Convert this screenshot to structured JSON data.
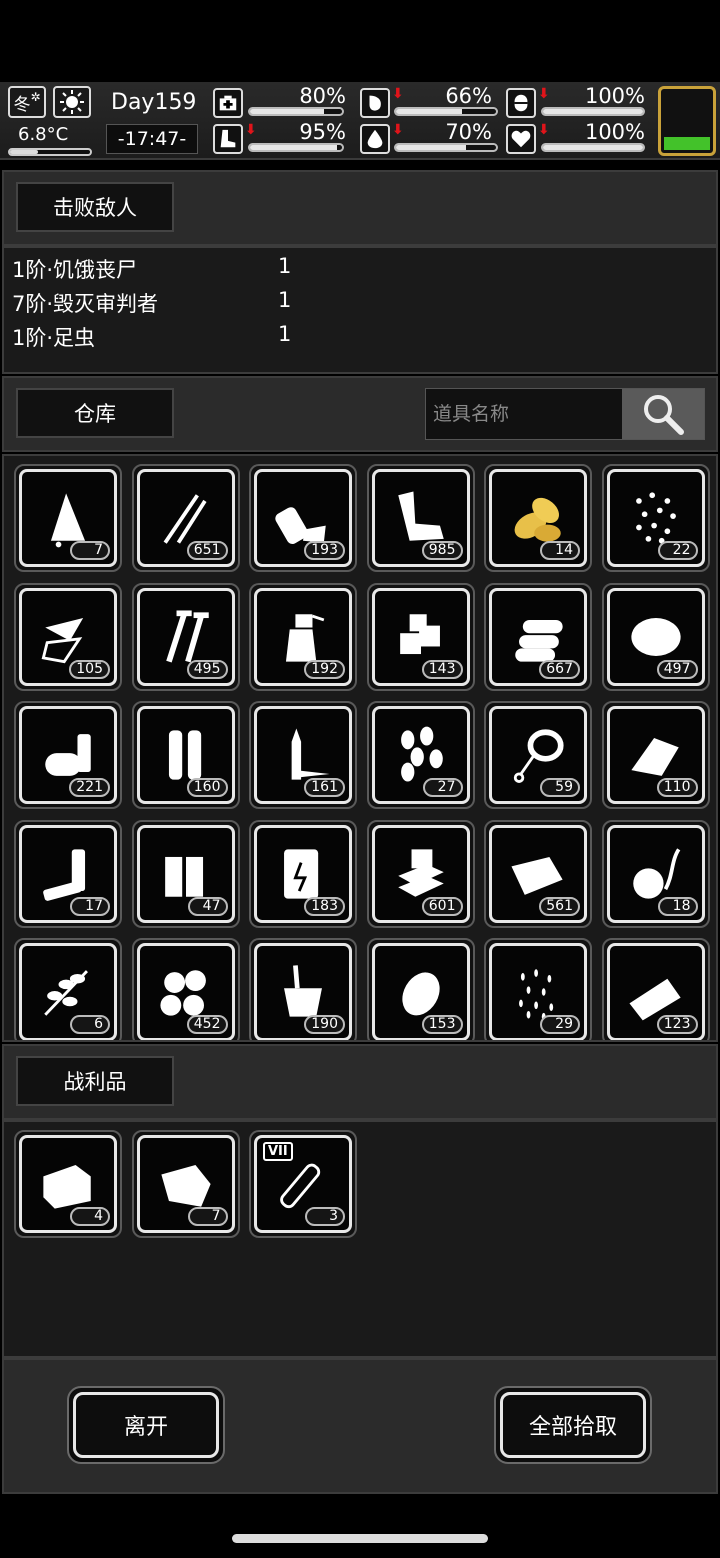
{
  "status": {
    "season": "冬",
    "temperature": "6.8°C",
    "temperature_level": 0.35,
    "day": "Day159",
    "time": "-17:47-",
    "stats": [
      {
        "name": "health",
        "icon": "medkit-icon",
        "value": "80%",
        "level": 0.8,
        "down": false
      },
      {
        "name": "hunger",
        "icon": "stomach-icon",
        "value": "66%",
        "level": 0.66,
        "down": true
      },
      {
        "name": "medicine",
        "icon": "pill-icon",
        "value": "100%",
        "level": 1.0,
        "down": true
      },
      {
        "name": "stamina",
        "icon": "boot-icon",
        "value": "95%",
        "level": 0.95,
        "down": true
      },
      {
        "name": "thirst",
        "icon": "water-drop-icon",
        "value": "70%",
        "level": 0.7,
        "down": true
      },
      {
        "name": "mood",
        "icon": "heart-icon",
        "value": "100%",
        "level": 1.0,
        "down": true
      }
    ],
    "battery_level": 0.3
  },
  "defeated": {
    "label": "击败敌人",
    "enemies": [
      {
        "name": "1阶·饥饿丧尸",
        "count": "1"
      },
      {
        "name": "7阶·毁灭审判者",
        "count": "1"
      },
      {
        "name": "1阶·足虫",
        "count": "1"
      }
    ]
  },
  "warehouse": {
    "label": "仓库",
    "search_placeholder": "道具名称",
    "items": [
      {
        "icon": "cloth-rag-icon",
        "qty": "7"
      },
      {
        "icon": "needle-tools-icon",
        "qty": "651"
      },
      {
        "icon": "plastic-bottle-icon",
        "qty": "193"
      },
      {
        "icon": "scrap-metal-icon",
        "qty": "985"
      },
      {
        "icon": "tobacco-leaf-icon",
        "qty": "14"
      },
      {
        "icon": "seeds-icon",
        "qty": "22"
      },
      {
        "icon": "glass-shards-icon",
        "qty": "105"
      },
      {
        "icon": "screws-icon",
        "qty": "495"
      },
      {
        "icon": "spray-bottle-icon",
        "qty": "192"
      },
      {
        "icon": "ice-cubes-icon",
        "qty": "143"
      },
      {
        "icon": "logs-icon",
        "qty": "667"
      },
      {
        "icon": "fiber-ball-icon",
        "qty": "497"
      },
      {
        "icon": "tape-roll-icon",
        "qty": "221"
      },
      {
        "icon": "shotgun-shells-icon",
        "qty": "160"
      },
      {
        "icon": "rifle-bullets-icon",
        "qty": "161"
      },
      {
        "icon": "peanuts-icon",
        "qty": "27"
      },
      {
        "icon": "rope-icon",
        "qty": "59"
      },
      {
        "icon": "bandage-roll-icon",
        "qty": "110"
      },
      {
        "icon": "batteries-aa-icon",
        "qty": "17"
      },
      {
        "icon": "battery-pack-icon",
        "qty": "47"
      },
      {
        "icon": "fuel-barrel-icon",
        "qty": "183"
      },
      {
        "icon": "planks-icon",
        "qty": "601"
      },
      {
        "icon": "cloth-sheets-icon",
        "qty": "561"
      },
      {
        "icon": "onion-icon",
        "qty": "18"
      },
      {
        "icon": "herb-branch-icon",
        "qty": "6"
      },
      {
        "icon": "chestnuts-icon",
        "qty": "452"
      },
      {
        "icon": "bucket-icon",
        "qty": "190"
      },
      {
        "icon": "potato-icon",
        "qty": "153"
      },
      {
        "icon": "grain-seeds-icon",
        "qty": "29"
      },
      {
        "icon": "bread-loaf-icon",
        "qty": "123"
      }
    ]
  },
  "loot": {
    "label": "战利品",
    "items": [
      {
        "icon": "folded-cloth-icon",
        "qty": "4"
      },
      {
        "icon": "raw-meat-icon",
        "qty": "7"
      },
      {
        "icon": "serum-vial-icon",
        "qty": "3",
        "badge": "VII"
      }
    ]
  },
  "actions": {
    "leave": "离开",
    "take_all": "全部拾取"
  }
}
